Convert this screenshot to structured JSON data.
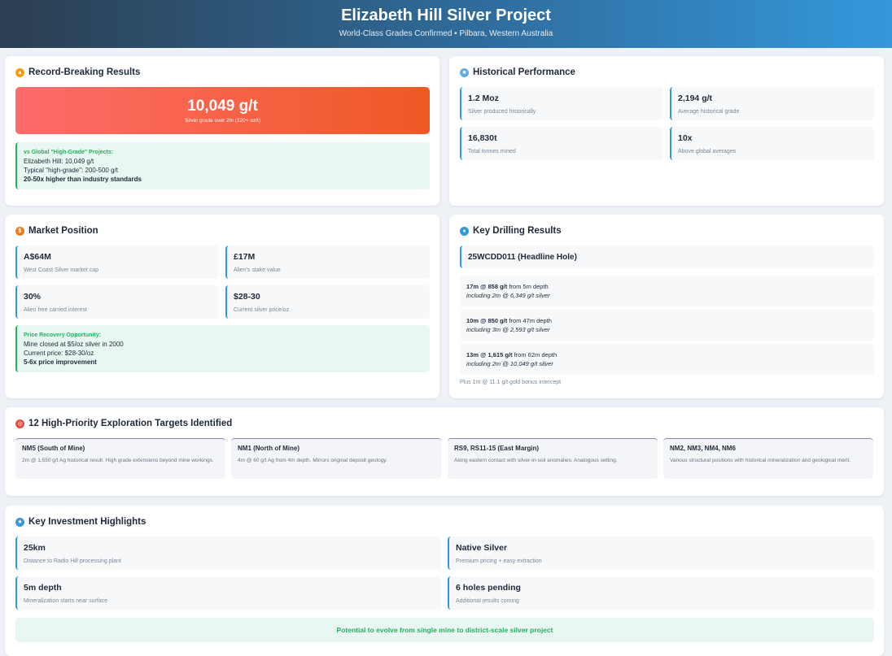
{
  "header": {
    "title": "Elizabeth Hill Silver Project",
    "subtitle": "World-Class Grades Confirmed • Pilbara, Western Australia"
  },
  "record": {
    "title": "Record-Breaking Results",
    "hero_value": "10,049 g/t",
    "hero_label": "Silver grade over 2m (320+ oz/t)",
    "compare_heading": "vs Global \"High-Grade\" Projects:",
    "compare_line1": "Elizabeth Hill: 10,049 g/t",
    "compare_line2": "Typical \"high-grade\": 200-500 g/t",
    "compare_line3": "20-50x higher than industry standards"
  },
  "historical": {
    "title": "Historical Performance",
    "stats": [
      {
        "value": "1.2 Moz",
        "label": "Silver produced historically"
      },
      {
        "value": "2,194 g/t",
        "label": "Average historical grade"
      },
      {
        "value": "16,830t",
        "label": "Total tonnes mined"
      },
      {
        "value": "10x",
        "label": "Above global averages"
      }
    ]
  },
  "market": {
    "title": "Market Position",
    "stats": [
      {
        "value": "A$64M",
        "label": "West Coast Silver market cap"
      },
      {
        "value": "£17M",
        "label": "Alien's stake value"
      },
      {
        "value": "30%",
        "label": "Alien free carried interest"
      },
      {
        "value": "$28-30",
        "label": "Current silver price/oz"
      }
    ],
    "recovery_heading": "Price Recovery Opportunity:",
    "recovery_line1": "Mine closed at $5/oz silver in 2000",
    "recovery_line2": "Current price: $28-30/oz",
    "recovery_line3": "5-6x price improvement"
  },
  "drilling": {
    "title": "Key Drilling Results",
    "headline": "25WCDD011 (Headline Hole)",
    "results": [
      {
        "main": "17m @ 858 g/t",
        "rest": " from 5m depth",
        "incl": "including 2m @ 6,349 g/t silver"
      },
      {
        "main": "10m @ 850 g/t",
        "rest": " from 47m depth",
        "incl": "including 3m @ 2,593 g/t silver"
      },
      {
        "main": "13m @ 1,615 g/t",
        "rest": " from 62m depth",
        "incl": "including 2m @ 10,049 g/t silver"
      }
    ],
    "note": "Plus 1m @ 11.1 g/t gold bonus intercept"
  },
  "targets": {
    "title": "12 High-Priority Exploration Targets Identified",
    "items": [
      {
        "name": "NM5 (South of Mine)",
        "desc": "2m @ 1,550 g/t Ag historical result. High grade extensions beyond mine workings."
      },
      {
        "name": "NM1 (North of Mine)",
        "desc": "4m @ 60 g/t Ag from 4m depth. Mirrors original deposit geology."
      },
      {
        "name": "RS9, RS11-15 (East Margin)",
        "desc": "Along eastern contact with silver-in-soil anomalies. Analogous setting."
      },
      {
        "name": "NM2, NM3, NM4, NM6",
        "desc": "Various structural positions with historical mineralization and geological merit."
      }
    ]
  },
  "highlights": {
    "title": "Key Investment Highlights",
    "stats": [
      {
        "value": "25km",
        "label": "Distance to Radio Hill processing plant"
      },
      {
        "value": "Native Silver",
        "label": "Premium pricing + easy extraction"
      },
      {
        "value": "5m depth",
        "label": "Mineralization starts near surface"
      },
      {
        "value": "6 holes pending",
        "label": "Additional results coming"
      }
    ],
    "potential": "Potential to evolve from single mine to district-scale silver project"
  },
  "colors": {
    "accent_blue": "#3498db",
    "hero_red": "#ee5a24",
    "green": "#27ae60",
    "target_purple": "#8e7cc3"
  }
}
